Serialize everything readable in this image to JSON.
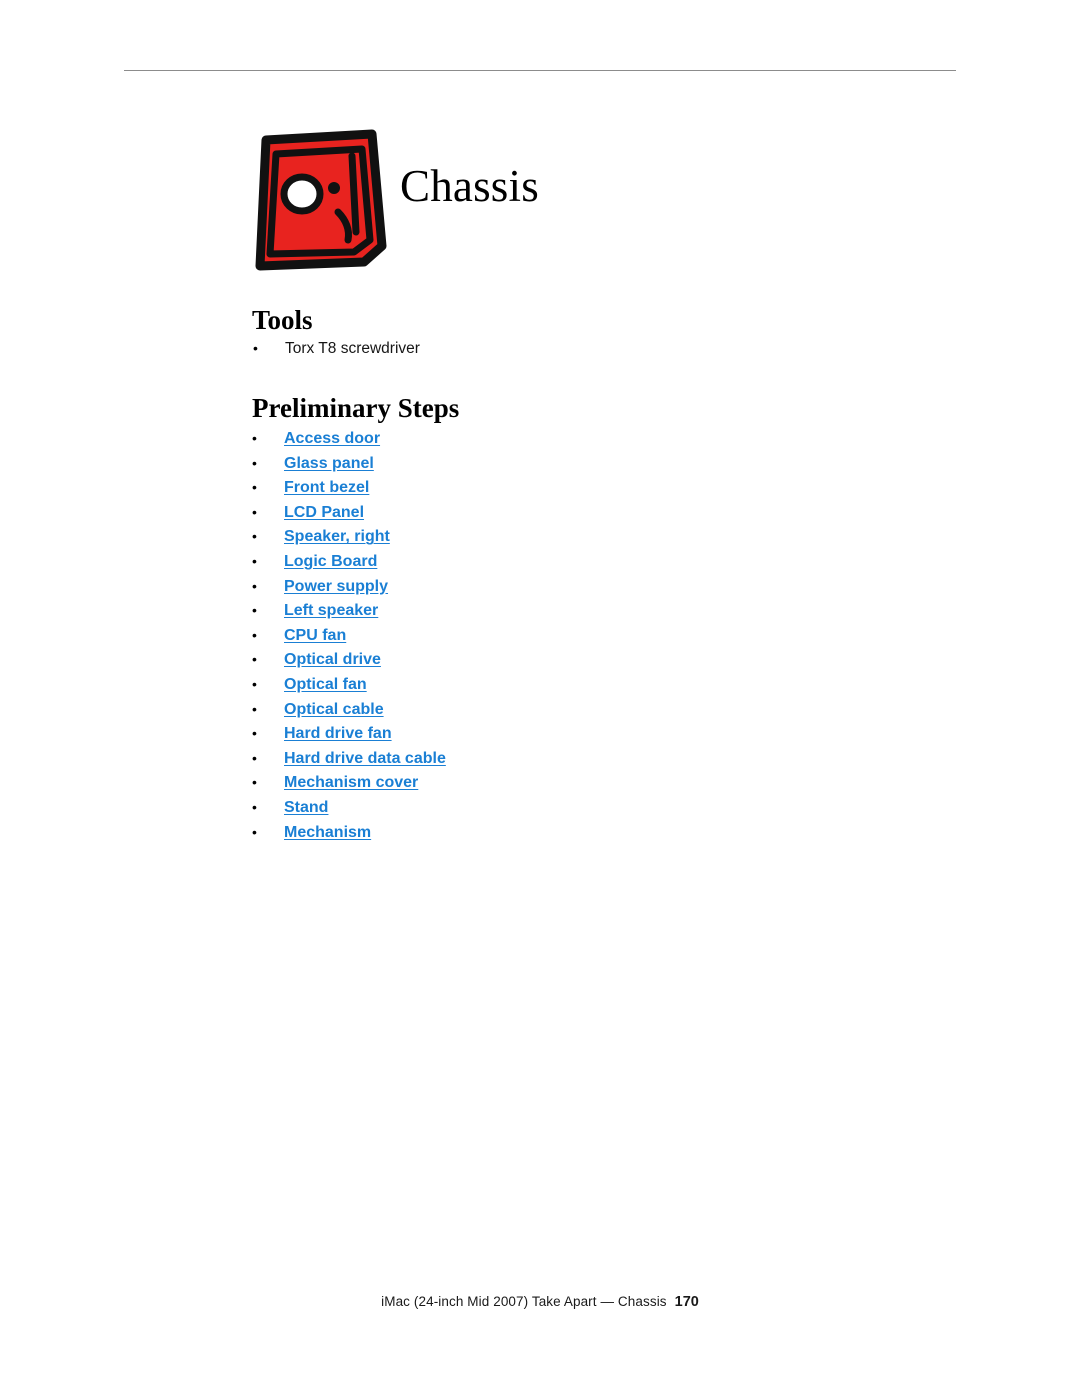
{
  "document": {
    "chapter_title": "Chassis",
    "chapter_icon": "chassis-icon"
  },
  "sections": {
    "tools": {
      "heading": "Tools",
      "items": [
        "Torx T8 screwdriver"
      ]
    },
    "preliminary_steps": {
      "heading": "Preliminary Steps",
      "items": [
        "Access door",
        "Glass panel ",
        "Front bezel",
        "LCD Panel",
        "Speaker, right",
        "Logic Board",
        "Power supply",
        "Left speaker",
        "CPU fan",
        "Optical drive",
        "Optical fan",
        "Optical cable",
        "Hard drive fan",
        "Hard drive data cable",
        "Mechanism cover",
        "Stand",
        "Mechanism"
      ]
    }
  },
  "bullet": "•",
  "footer": {
    "text": "iMac (24-inch Mid 2007) Take Apart — Chassis",
    "page_number": "170"
  },
  "colors": {
    "link": "#1a7fd4",
    "icon_red": "#e8231f",
    "rule": "#8c8c8c"
  }
}
